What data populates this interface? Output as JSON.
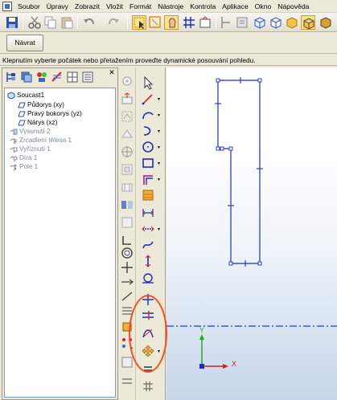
{
  "menubar": {
    "items": [
      "Soubor",
      "Úpravy",
      "Zobrazit",
      "Vložit",
      "Formát",
      "Nástroje",
      "Kontrola",
      "Aplikace",
      "Okno",
      "Nápověda"
    ]
  },
  "toolbar2": {
    "back_label": "Návrat"
  },
  "prompt": {
    "text": "Klepnutím vyberte počátek nebo přetažením proveďte dynamické posouvání pohledu."
  },
  "tree": {
    "root": "Soucast1",
    "items": [
      {
        "label": "Půdorys (xy)",
        "state": "active"
      },
      {
        "label": "Pravý bokorys (yz)",
        "state": "active"
      },
      {
        "label": "Nárys (xz)",
        "state": "active"
      },
      {
        "label": "Vysunutí 2",
        "state": "inactive"
      },
      {
        "label": "Zrcadlení tělesa 1",
        "state": "inactive"
      },
      {
        "label": "Vyříznutí 1",
        "state": "inactive"
      },
      {
        "label": "Díra 1",
        "state": "inactive"
      },
      {
        "label": "Pole 1",
        "state": "inactive"
      }
    ]
  },
  "axes": {
    "y_label": "Y",
    "x_label": "X"
  },
  "colors": {
    "sketch": "#1b2fbf",
    "axis_line": "#1f3ccf",
    "y_axis": "#2aa52a",
    "x_axis": "#d61f1f",
    "annotation": "#ff4a1a"
  }
}
